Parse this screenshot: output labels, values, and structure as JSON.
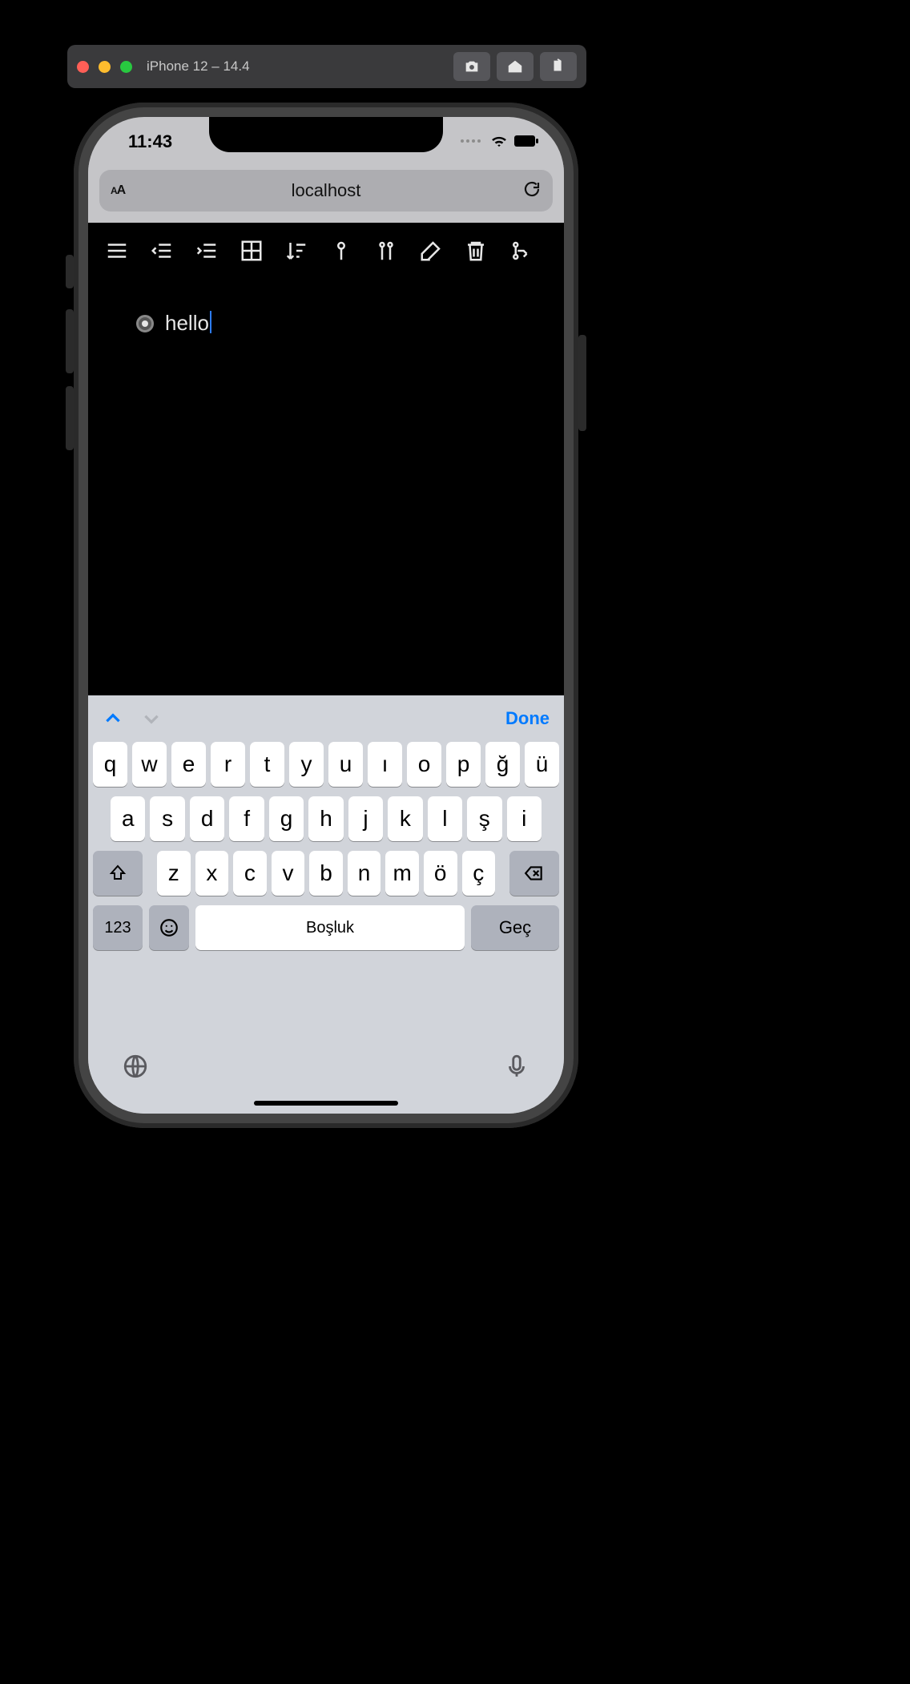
{
  "simulator": {
    "title": "iPhone 12 – 14.4",
    "tools": [
      "screenshot-icon",
      "home-icon",
      "rotate-icon"
    ]
  },
  "status": {
    "time": "11:43"
  },
  "safari": {
    "aa_label": "AA",
    "address": "localhost"
  },
  "note": {
    "text": "hello"
  },
  "keyboard": {
    "done_label": "Done",
    "row1": [
      "q",
      "w",
      "e",
      "r",
      "t",
      "y",
      "u",
      "ı",
      "o",
      "p",
      "ğ",
      "ü"
    ],
    "row2": [
      "a",
      "s",
      "d",
      "f",
      "g",
      "h",
      "j",
      "k",
      "l",
      "ş",
      "i"
    ],
    "row3": [
      "z",
      "x",
      "c",
      "v",
      "b",
      "n",
      "m",
      "ö",
      "ç"
    ],
    "numbers_label": "123",
    "space_label": "Boşluk",
    "next_label": "Geç"
  }
}
